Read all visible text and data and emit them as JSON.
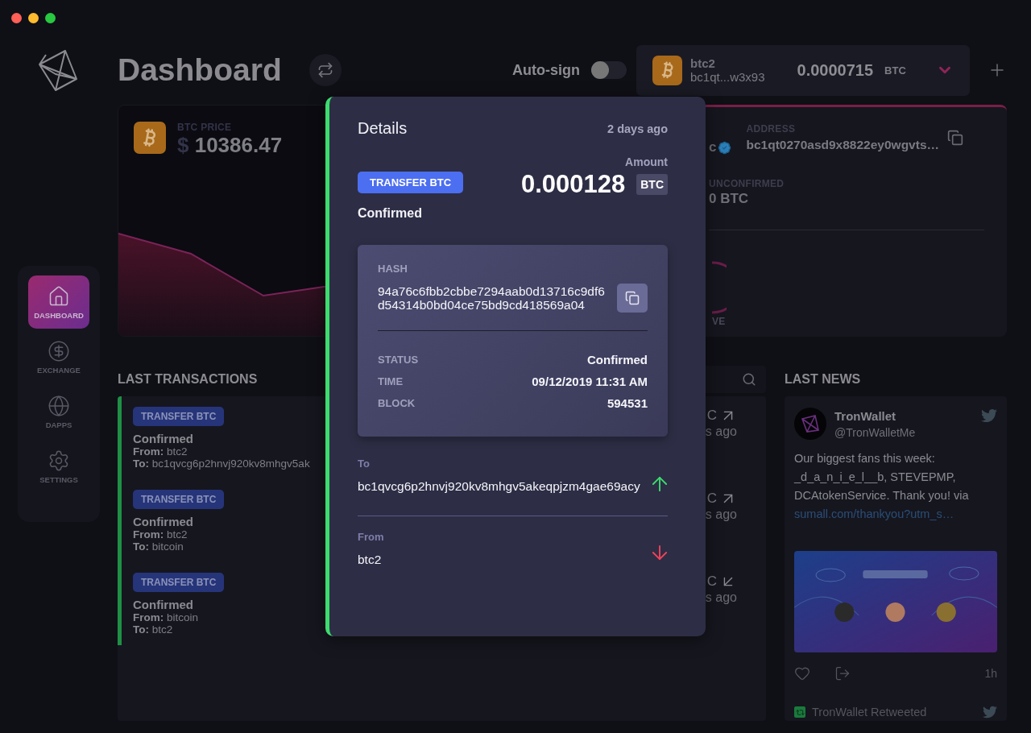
{
  "sidebar": {
    "items": [
      {
        "label": "DASHBOARD",
        "selected": true
      },
      {
        "label": "EXCHANGE",
        "selected": false
      },
      {
        "label": "DAPPS",
        "selected": false
      },
      {
        "label": "SETTINGS",
        "selected": false
      }
    ]
  },
  "header": {
    "title": "Dashboard",
    "auto_sign": {
      "label": "Auto-sign",
      "on": false
    },
    "wallet": {
      "name": "btc2",
      "address": "bc1qt...w3x93",
      "balance": "0.0000715",
      "unit": "BTC"
    }
  },
  "price_card": {
    "label": "BTC PRICE",
    "currency": "$",
    "value": "10386.47"
  },
  "wallet_card": {
    "name_fragment": "c",
    "verified": true,
    "address_label": "ADDRESS",
    "address": "bc1qt0270asd9x8822ey0wgvts…",
    "unconfirmed_label": "UNCONFIRMED",
    "unconfirmed": "0 BTC",
    "action_fragment": "VE"
  },
  "transactions": {
    "title": "LAST TRANSACTIONS",
    "rows": [
      {
        "type": "TRANSFER BTC",
        "status": "Confirmed",
        "from": "**From:** btc2",
        "to": "**To:** bc1qvcg6p2hnvj920kv8mhgv5ak",
        "amount_fragment": "C",
        "time_fragment": "s ago",
        "kind": "outgoing"
      },
      {
        "type": "TRANSFER BTC",
        "status": "Confirmed",
        "from": "**From:** btc2",
        "to": "**To:** bitcoin",
        "amount_fragment": "C",
        "time_fragment": "s ago",
        "kind": "outgoing"
      },
      {
        "type": "TRANSFER BTC",
        "status": "Confirmed",
        "from": "**From:** bitcoin",
        "to": "**To:** btc2",
        "amount_fragment": "C",
        "time_fragment": "s ago",
        "kind": "incoming"
      }
    ]
  },
  "news": {
    "title": "LAST NEWS",
    "tweet": {
      "author": "TronWallet",
      "handle": "@TronWalletMe",
      "text": "Our biggest fans this week: _d_a_n_i_e_l__b, STEVEPMP, DCAtokenService. Thank you! via",
      "link": "sumall.com/thankyou?utm_s…",
      "time": "1h"
    },
    "retweet": "TronWallet Retweeted"
  },
  "details": {
    "title": "Details",
    "time": "2 days ago",
    "type": "TRANSFER BTC",
    "status": "Confirmed",
    "amount_label": "Amount",
    "amount": "0.000128",
    "unit": "BTC",
    "hash_label": "HASH",
    "hash": "94a76c6fbb2cbbe7294aab0d13716c9df6d54314b0bd04ce75bd9cd418569a04",
    "fields": [
      {
        "label": "STATUS",
        "value": "Confirmed"
      },
      {
        "label": "TIME",
        "value": "09/12/2019 11:31 AM"
      },
      {
        "label": "BLOCK",
        "value": "594531"
      }
    ],
    "to_label": "To",
    "to": "bc1qvcg6p2hnvj920kv8mhgv5akeqpjzm4gae69acy",
    "from_label": "From",
    "from": "btc2"
  }
}
